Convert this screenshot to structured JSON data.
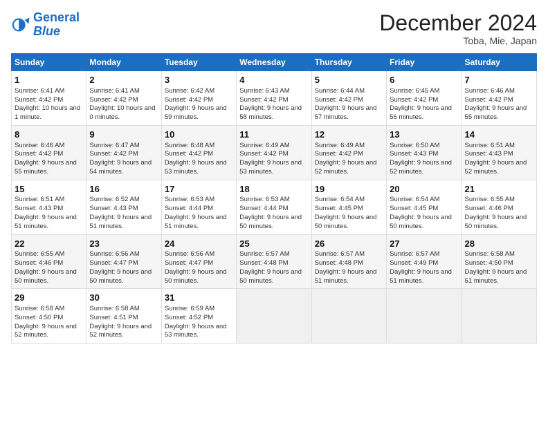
{
  "header": {
    "logo_line1": "General",
    "logo_line2": "Blue",
    "month": "December 2024",
    "location": "Toba, Mie, Japan"
  },
  "weekdays": [
    "Sunday",
    "Monday",
    "Tuesday",
    "Wednesday",
    "Thursday",
    "Friday",
    "Saturday"
  ],
  "weeks": [
    [
      {
        "day": "1",
        "sunrise": "6:41 AM",
        "sunset": "4:42 PM",
        "daylight": "10 hours and 1 minute."
      },
      {
        "day": "2",
        "sunrise": "6:41 AM",
        "sunset": "4:42 PM",
        "daylight": "10 hours and 0 minutes."
      },
      {
        "day": "3",
        "sunrise": "6:42 AM",
        "sunset": "4:42 PM",
        "daylight": "9 hours and 59 minutes."
      },
      {
        "day": "4",
        "sunrise": "6:43 AM",
        "sunset": "4:42 PM",
        "daylight": "9 hours and 58 minutes."
      },
      {
        "day": "5",
        "sunrise": "6:44 AM",
        "sunset": "4:42 PM",
        "daylight": "9 hours and 57 minutes."
      },
      {
        "day": "6",
        "sunrise": "6:45 AM",
        "sunset": "4:42 PM",
        "daylight": "9 hours and 56 minutes."
      },
      {
        "day": "7",
        "sunrise": "6:46 AM",
        "sunset": "4:42 PM",
        "daylight": "9 hours and 55 minutes."
      }
    ],
    [
      {
        "day": "8",
        "sunrise": "6:46 AM",
        "sunset": "4:42 PM",
        "daylight": "9 hours and 55 minutes."
      },
      {
        "day": "9",
        "sunrise": "6:47 AM",
        "sunset": "4:42 PM",
        "daylight": "9 hours and 54 minutes."
      },
      {
        "day": "10",
        "sunrise": "6:48 AM",
        "sunset": "4:42 PM",
        "daylight": "9 hours and 53 minutes."
      },
      {
        "day": "11",
        "sunrise": "6:49 AM",
        "sunset": "4:42 PM",
        "daylight": "9 hours and 53 minutes."
      },
      {
        "day": "12",
        "sunrise": "6:49 AM",
        "sunset": "4:42 PM",
        "daylight": "9 hours and 52 minutes."
      },
      {
        "day": "13",
        "sunrise": "6:50 AM",
        "sunset": "4:43 PM",
        "daylight": "9 hours and 52 minutes."
      },
      {
        "day": "14",
        "sunrise": "6:51 AM",
        "sunset": "4:43 PM",
        "daylight": "9 hours and 52 minutes."
      }
    ],
    [
      {
        "day": "15",
        "sunrise": "6:51 AM",
        "sunset": "4:43 PM",
        "daylight": "9 hours and 51 minutes."
      },
      {
        "day": "16",
        "sunrise": "6:52 AM",
        "sunset": "4:43 PM",
        "daylight": "9 hours and 51 minutes."
      },
      {
        "day": "17",
        "sunrise": "6:53 AM",
        "sunset": "4:44 PM",
        "daylight": "9 hours and 51 minutes."
      },
      {
        "day": "18",
        "sunrise": "6:53 AM",
        "sunset": "4:44 PM",
        "daylight": "9 hours and 50 minutes."
      },
      {
        "day": "19",
        "sunrise": "6:54 AM",
        "sunset": "4:45 PM",
        "daylight": "9 hours and 50 minutes."
      },
      {
        "day": "20",
        "sunrise": "6:54 AM",
        "sunset": "4:45 PM",
        "daylight": "9 hours and 50 minutes."
      },
      {
        "day": "21",
        "sunrise": "6:55 AM",
        "sunset": "4:46 PM",
        "daylight": "9 hours and 50 minutes."
      }
    ],
    [
      {
        "day": "22",
        "sunrise": "6:55 AM",
        "sunset": "4:46 PM",
        "daylight": "9 hours and 50 minutes."
      },
      {
        "day": "23",
        "sunrise": "6:56 AM",
        "sunset": "4:47 PM",
        "daylight": "9 hours and 50 minutes."
      },
      {
        "day": "24",
        "sunrise": "6:56 AM",
        "sunset": "4:47 PM",
        "daylight": "9 hours and 50 minutes."
      },
      {
        "day": "25",
        "sunrise": "6:57 AM",
        "sunset": "4:48 PM",
        "daylight": "9 hours and 50 minutes."
      },
      {
        "day": "26",
        "sunrise": "6:57 AM",
        "sunset": "4:48 PM",
        "daylight": "9 hours and 51 minutes."
      },
      {
        "day": "27",
        "sunrise": "6:57 AM",
        "sunset": "4:49 PM",
        "daylight": "9 hours and 51 minutes."
      },
      {
        "day": "28",
        "sunrise": "6:58 AM",
        "sunset": "4:50 PM",
        "daylight": "9 hours and 51 minutes."
      }
    ],
    [
      {
        "day": "29",
        "sunrise": "6:58 AM",
        "sunset": "4:50 PM",
        "daylight": "9 hours and 52 minutes."
      },
      {
        "day": "30",
        "sunrise": "6:58 AM",
        "sunset": "4:51 PM",
        "daylight": "9 hours and 52 minutes."
      },
      {
        "day": "31",
        "sunrise": "6:59 AM",
        "sunset": "4:52 PM",
        "daylight": "9 hours and 53 minutes."
      },
      null,
      null,
      null,
      null
    ]
  ]
}
